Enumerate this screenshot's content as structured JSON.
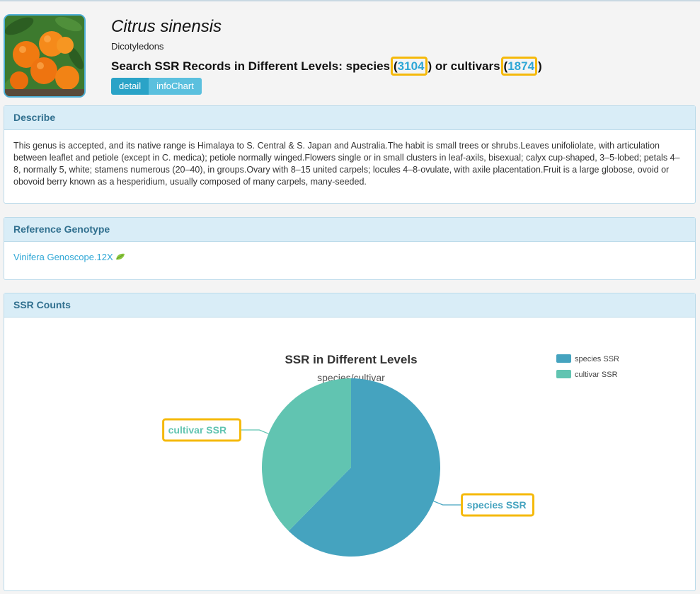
{
  "header": {
    "species_name": "Citrus sinensis",
    "classification": "Dicotyledons",
    "search_prefix": "Search SSR Records in Different Levels: species",
    "species_count": "3104",
    "or_text": " or cultivars",
    "cultivar_count": "1874",
    "open_paren": "(",
    "close_paren": ")",
    "buttons": {
      "detail": "detail",
      "infochart": "infoChart"
    }
  },
  "describe": {
    "heading": "Describe",
    "text": "This genus is accepted, and its native range is Himalaya to S. Central & S. Japan and Australia.The habit is small trees or shrubs.Leaves unifoliolate, with articulation between leaflet and petiole (except in C. medica); petiole normally winged.Flowers single or in small clusters in leaf-axils, bisexual; calyx cup-shaped, 3–5-lobed; petals 4–8, normally 5, white; stamens numerous (20–40), in groups.Ovary with 8–15 united carpels; locules 4–8-ovulate, with axile placentation.Fruit is a large globose, ovoid or obovoid berry known as a hesperidium, usually composed of many carpels, many-seeded."
  },
  "reference": {
    "heading": "Reference Genotype",
    "link_text": "Vinifera Genoscope.12X",
    "icon": "leaf-icon"
  },
  "ssr_counts": {
    "heading": "SSR Counts"
  },
  "chart_data": {
    "type": "pie",
    "title": "SSR in Different Levels",
    "subtitle": "species/cultivar",
    "categories": [
      "species SSR",
      "cultivar SSR"
    ],
    "values": [
      3104,
      1874
    ],
    "colors": [
      "#45a3bf",
      "#61c4b1"
    ],
    "legend": "top-right",
    "highlight_color": "#f5b90a"
  }
}
